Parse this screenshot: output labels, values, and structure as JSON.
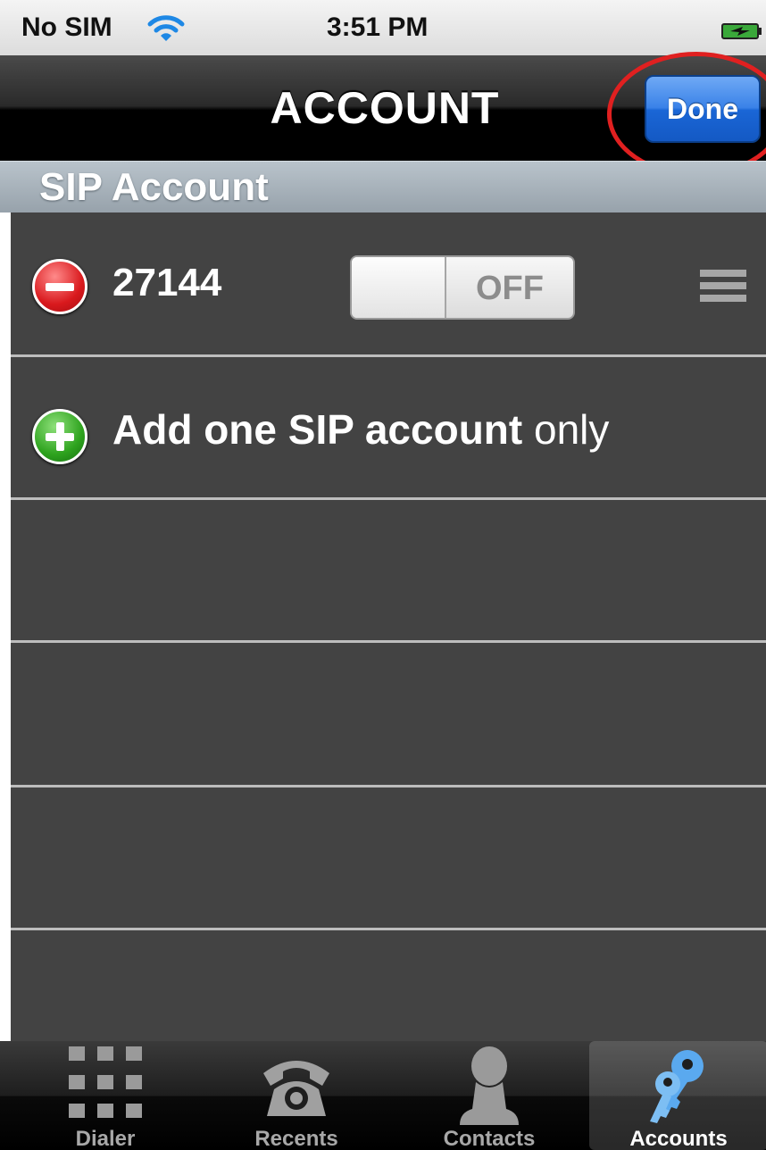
{
  "status_bar": {
    "carrier": "No SIM",
    "time": "3:51 PM",
    "wifi_icon": "wifi-icon",
    "battery_icon": "battery-charging-icon"
  },
  "nav": {
    "title": "ACCOUNT",
    "done_label": "Done",
    "done_color": "#1a66d6",
    "highlight_color": "#e02020"
  },
  "section": {
    "header": "SIP Account"
  },
  "accounts": [
    {
      "number": "27144",
      "toggle_label": "OFF",
      "enabled": false,
      "delete_icon": "minus-circle-icon",
      "reorder_icon": "reorder-icon"
    }
  ],
  "add_row": {
    "label_bold": "Add one SIP account",
    "label_regular": "only",
    "icon": "plus-circle-icon"
  },
  "tabs": [
    {
      "label": "Dialer",
      "icon": "keypad-icon",
      "active": false
    },
    {
      "label": "Recents",
      "icon": "phone-icon",
      "active": false
    },
    {
      "label": "Contacts",
      "icon": "person-icon",
      "active": false
    },
    {
      "label": "Accounts",
      "icon": "keys-icon",
      "active": true
    }
  ]
}
